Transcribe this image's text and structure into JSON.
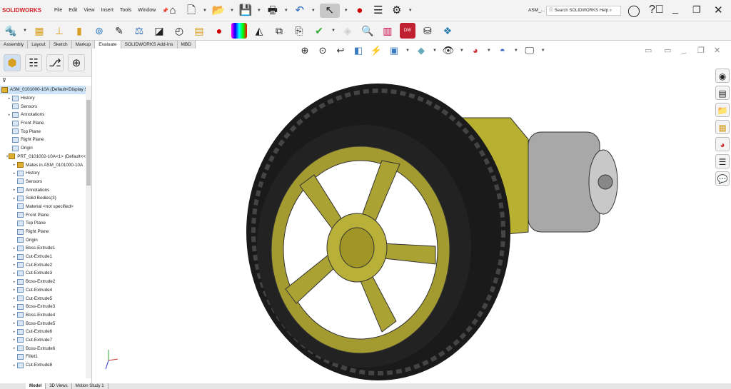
{
  "app": {
    "logo": "SOLIDWORKS",
    "doc_title": "ASM_...",
    "search_placeholder": "Search SOLIDWORKS Help"
  },
  "menu": [
    "File",
    "Edit",
    "View",
    "Insert",
    "Tools",
    "Window"
  ],
  "tabs": [
    {
      "label": "Assembly"
    },
    {
      "label": "Layout"
    },
    {
      "label": "Sketch"
    },
    {
      "label": "Markup"
    },
    {
      "label": "Evaluate",
      "active": true
    },
    {
      "label": "SOLIDWORKS Add-Ins"
    },
    {
      "label": "MBD"
    }
  ],
  "tree": [
    {
      "label": "ASM_0101000-10A  (Default<Display S",
      "level": 0,
      "exp": false,
      "sel": true
    },
    {
      "label": "History",
      "level": 1,
      "exp": true
    },
    {
      "label": "Sensors",
      "level": 1,
      "exp": false
    },
    {
      "label": "Annotations",
      "level": 1,
      "exp": true
    },
    {
      "label": "Front Plane",
      "level": 1,
      "exp": false
    },
    {
      "label": "Top Plane",
      "level": 1,
      "exp": false
    },
    {
      "label": "Right Plane",
      "level": 1,
      "exp": false
    },
    {
      "label": "Origin",
      "level": 1,
      "exp": false
    },
    {
      "label": "PRT_0101002-10A<1> (Default<<",
      "level": 1,
      "exp": true
    },
    {
      "label": "Mates in ASM_0101000-10A",
      "level": 2,
      "exp": true
    },
    {
      "label": "History",
      "level": 2,
      "exp": true
    },
    {
      "label": "Sensors",
      "level": 2,
      "exp": false
    },
    {
      "label": "Annotations",
      "level": 2,
      "exp": true
    },
    {
      "label": "Solid Bodies(3)",
      "level": 2,
      "exp": true
    },
    {
      "label": "Material <not specified>",
      "level": 2,
      "exp": false
    },
    {
      "label": "Front Plane",
      "level": 2,
      "exp": false
    },
    {
      "label": "Top Plane",
      "level": 2,
      "exp": false
    },
    {
      "label": "Right Plane",
      "level": 2,
      "exp": false
    },
    {
      "label": "Origin",
      "level": 2,
      "exp": false
    },
    {
      "label": "Boss-Extrude1",
      "level": 2,
      "exp": true
    },
    {
      "label": "Cut-Extrude1",
      "level": 2,
      "exp": true
    },
    {
      "label": "Cut-Extrude2",
      "level": 2,
      "exp": true
    },
    {
      "label": "Cut-Extrude3",
      "level": 2,
      "exp": true
    },
    {
      "label": "Boss-Extrude2",
      "level": 2,
      "exp": true
    },
    {
      "label": "Cut-Extrude4",
      "level": 2,
      "exp": true
    },
    {
      "label": "Cut-Extrude5",
      "level": 2,
      "exp": true
    },
    {
      "label": "Boss-Extrude3",
      "level": 2,
      "exp": true
    },
    {
      "label": "Boss-Extrude4",
      "level": 2,
      "exp": true
    },
    {
      "label": "Boss-Extrude5",
      "level": 2,
      "exp": true
    },
    {
      "label": "Cut-Extrude6",
      "level": 2,
      "exp": true
    },
    {
      "label": "Cut-Extrude7",
      "level": 2,
      "exp": true
    },
    {
      "label": "Boss-Extrude6",
      "level": 2,
      "exp": true
    },
    {
      "label": "Fillet1",
      "level": 2,
      "exp": false
    },
    {
      "label": "Cut-Extrude8",
      "level": 2,
      "exp": true
    }
  ],
  "bottom_tabs": [
    {
      "label": "Model",
      "active": true
    },
    {
      "label": "3D Views"
    },
    {
      "label": "Motion Study 1"
    }
  ]
}
